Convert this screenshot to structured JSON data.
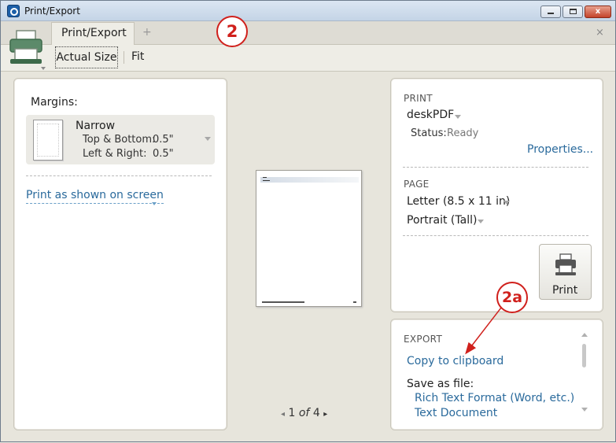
{
  "window": {
    "title": "Print/Export",
    "min_glyph": "",
    "close_glyph": "x"
  },
  "tabs": {
    "active_label": "Print/Export",
    "add_label": "+",
    "close_label": "×"
  },
  "toolbar": {
    "actual_size": "Actual Size",
    "fit": "Fit"
  },
  "annotations": {
    "callout_main": "2",
    "callout_sub": "2a",
    "callout_color": "#d0201c"
  },
  "margins": {
    "label": "Margins:",
    "preset": "Narrow",
    "top_bottom_label": "Top & Bottom:",
    "top_bottom_value": "0.5\"",
    "left_right_label": "Left & Right:",
    "left_right_value": "0.5\"",
    "print_as_shown": "Print as shown on screen"
  },
  "preview": {
    "current_page": "1",
    "of_label": "of",
    "total_pages": "4"
  },
  "print": {
    "section": "PRINT",
    "printer": "deskPDF",
    "status_label": "Status:",
    "status_value": "Ready",
    "properties": "Properties...",
    "button_label": "Print"
  },
  "page": {
    "section": "PAGE",
    "paper_size": "Letter (8.5 x 11 in)",
    "orientation": "Portrait (Tall)"
  },
  "export": {
    "section": "EXPORT",
    "copy_to_clipboard": "Copy to clipboard",
    "save_as_label": "Save as file:",
    "formats": [
      "Rich Text Format (Word, etc.)",
      "Text Document"
    ]
  },
  "colors": {
    "link": "#2a6a9c",
    "panel_bg": "#ffffff",
    "chrome_bg": "#e7e5dc"
  },
  "icons": [
    "app-icon",
    "printer-icon",
    "minimize-icon",
    "maximize-icon",
    "close-icon",
    "chevron-down-icon",
    "page-thumbnail-icon",
    "prev-page-icon",
    "next-page-icon",
    "scroll-up-icon",
    "scroll-down-icon"
  ]
}
